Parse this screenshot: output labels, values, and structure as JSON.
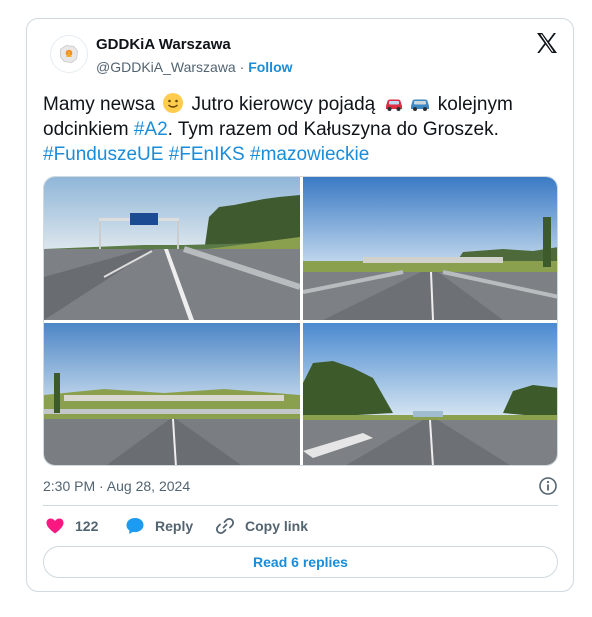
{
  "author": {
    "name": "GDDKiA Warszawa",
    "handle": "@GDDKiA_Warszawa",
    "separator": " · ",
    "follow_label": "Follow"
  },
  "tweet": {
    "line1_before": "Mamy newsa",
    "line1_middle": " Jutro kierowcy pojadą",
    "line1_after": " kolejnym",
    "line2_before": "odcinkiem ",
    "line2_tag": "#A2",
    "line2_after": ". Tym razem od Kałuszyna do Groszek.",
    "hashtags": [
      "#FunduszeUE",
      "#FEnIKS",
      "#mazowieckie"
    ]
  },
  "icons": {
    "platform": "x-logo-icon",
    "emoji_1": "smiley-face-emoji",
    "emoji_2": "red-car-emoji",
    "emoji_3": "blue-car-emoji",
    "info": "info-icon",
    "like": "heart-icon",
    "reply": "speech-bubble-icon",
    "copy": "link-icon"
  },
  "meta": {
    "timestamp": "2:30 PM · Aug 28, 2024"
  },
  "actions": {
    "like_count": "122",
    "reply_label": "Reply",
    "copy_label": "Copy link",
    "read_replies_label": "Read 6 replies"
  },
  "colors": {
    "accent": "#1a8cd8",
    "heart": "#f91880",
    "text": "#0f1419",
    "muted": "#536471",
    "border": "#cfd9de"
  }
}
